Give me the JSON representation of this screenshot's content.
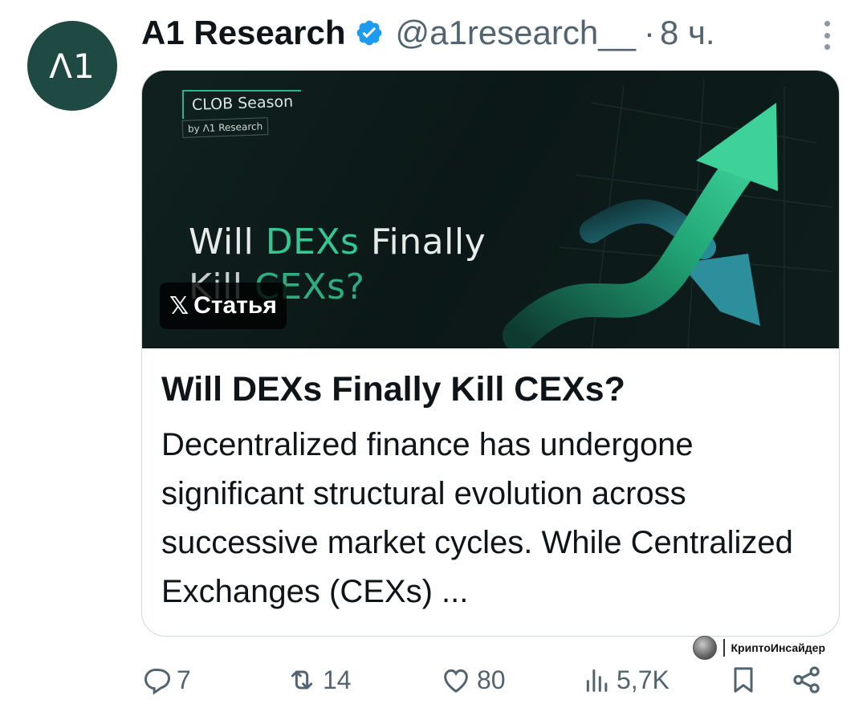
{
  "avatar": {
    "text": "Λ1"
  },
  "author": {
    "display_name": "A1 Research",
    "handle": "@a1research__",
    "separator": "·",
    "time": "8 ч."
  },
  "card": {
    "image": {
      "season_label": "CLOB Season",
      "by_label": "by Λ1 Research",
      "headline_word_1": "Will ",
      "headline_accent": "DEXs",
      "headline_word_2": " Finally",
      "headline_line_2_pre": "Kill ",
      "headline_line_2_accent": "CEXs?",
      "badge_label": "Статья"
    },
    "title": "Will DEXs Finally Kill CEXs?",
    "description": "Decentralized finance has undergone significant structural evolution across successive market cycles. While Centralized Exchanges (CEXs) ..."
  },
  "watermark": {
    "text": "КриптоИнсайдер"
  },
  "actions": {
    "replies": "7",
    "reposts": "14",
    "likes": "80",
    "views": "5,7K"
  },
  "colors": {
    "accent_green": "#33c792",
    "verified_blue": "#1d9bf0",
    "muted_text": "#536471"
  },
  "icons": [
    "verified-badge-icon",
    "more-options-icon",
    "x-logo-icon",
    "reply-icon",
    "repost-icon",
    "like-icon",
    "views-icon",
    "bookmark-icon",
    "share-icon"
  ]
}
